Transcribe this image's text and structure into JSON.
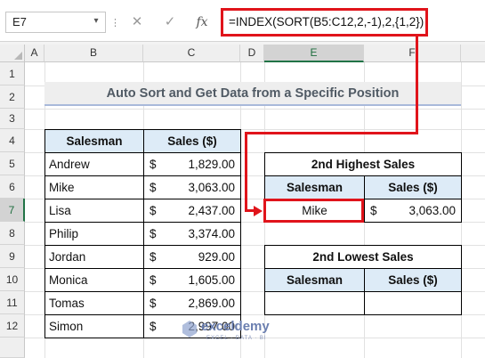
{
  "formula_bar": {
    "name_box": "E7",
    "fx_label": "fx",
    "formula": "=INDEX(SORT(B5:C12,2,-1),2,{1,2})"
  },
  "columns": [
    "A",
    "B",
    "C",
    "D",
    "E",
    "F"
  ],
  "rows": [
    "1",
    "2",
    "3",
    "4",
    "5",
    "6",
    "7",
    "8",
    "9",
    "10",
    "11",
    "12"
  ],
  "title": "Auto Sort and Get Data from a Specific Position",
  "main_table": {
    "headers": [
      "Salesman",
      "Sales ($)"
    ],
    "currency_symbol": "$",
    "rows": [
      {
        "name": "Andrew",
        "sales": "1,829.00"
      },
      {
        "name": "Mike",
        "sales": "3,063.00"
      },
      {
        "name": "Lisa",
        "sales": "2,437.00"
      },
      {
        "name": "Philip",
        "sales": "3,374.00"
      },
      {
        "name": "Jordan",
        "sales": "929.00"
      },
      {
        "name": "Monica",
        "sales": "1,605.00"
      },
      {
        "name": "Tomas",
        "sales": "2,869.00"
      },
      {
        "name": "Simon",
        "sales": "2,997.00"
      }
    ]
  },
  "highest_table": {
    "title": "2nd Highest Sales",
    "headers": [
      "Salesman",
      "Sales ($)"
    ],
    "result_name": "Mike",
    "currency_symbol": "$",
    "result_sales": "3,063.00"
  },
  "lowest_table": {
    "title": "2nd Lowest Sales",
    "headers": [
      "Salesman",
      "Sales ($)"
    ]
  },
  "watermark": {
    "name": "exceldemy",
    "tagline": "EXCEL · DATA · BI"
  },
  "colors": {
    "accent_red": "#e0141b",
    "header_fill": "#ddebf7",
    "title_fill": "#eeeeee",
    "excel_green": "#217346"
  }
}
